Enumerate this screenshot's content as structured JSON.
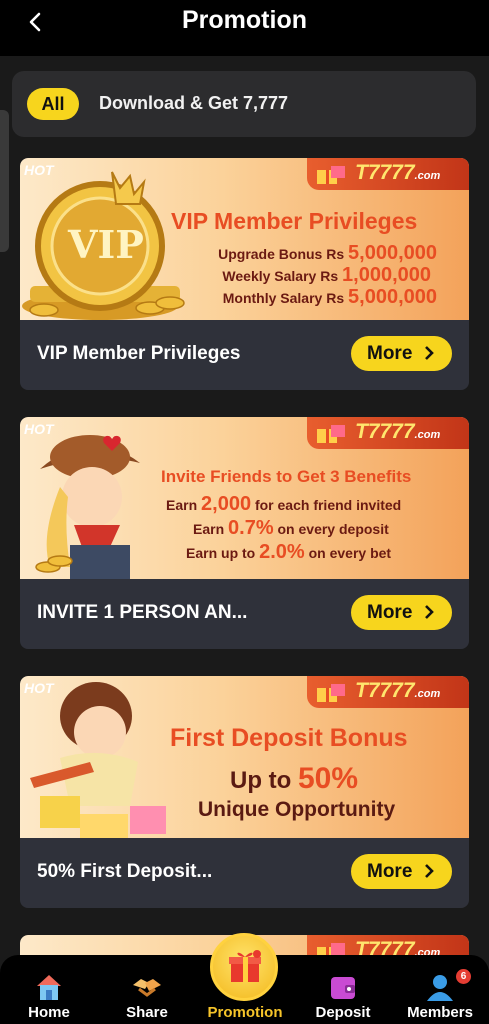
{
  "header": {
    "title": "Promotion"
  },
  "filter": {
    "all_label": "All",
    "category_label": "Download & Get 7,777"
  },
  "brand": {
    "name": "T7777",
    "suffix": ".com",
    "hot": "HOT"
  },
  "cards": [
    {
      "title": "VIP Member Privileges",
      "more": "More",
      "banner_head": "VIP Member Privileges",
      "badge_text": "VIP",
      "lines": [
        {
          "label": "Upgrade Bonus Rs ",
          "value": "5,000,000"
        },
        {
          "label": "Weekly Salary Rs ",
          "value": "1,000,000"
        },
        {
          "label": "Monthly Salary Rs ",
          "value": "5,000,000"
        }
      ]
    },
    {
      "title": "INVITE 1 PERSON AN...",
      "more": "More",
      "banner_head": "Invite Friends to Get 3 Benefits",
      "lines": [
        {
          "pre": "Earn ",
          "value": "2,000",
          "post": " for each friend invited"
        },
        {
          "pre": "Earn ",
          "value": "0.7%",
          "post": " on every deposit"
        },
        {
          "pre": "Earn up to ",
          "value": "2.0%",
          "post": " on every bet"
        }
      ]
    },
    {
      "title": "50% First Deposit...",
      "more": "More",
      "banner_head": "First Deposit Bonus",
      "line1_pre": "Up to ",
      "line1_value": "50%",
      "line2": "Unique Opportunity"
    }
  ],
  "nav": {
    "items": [
      {
        "label": "Home",
        "icon": "house-icon"
      },
      {
        "label": "Share",
        "icon": "handshake-icon"
      },
      {
        "label": "Promotion",
        "icon": "gift-icon",
        "active": true
      },
      {
        "label": "Deposit",
        "icon": "wallet-icon"
      },
      {
        "label": "Members",
        "icon": "person-icon",
        "badge": "6"
      }
    ]
  },
  "colors": {
    "accent": "#f7d51d",
    "card_bg": "#2f313a",
    "background": "#1a1a1a",
    "active_nav": "#f7c52a"
  }
}
